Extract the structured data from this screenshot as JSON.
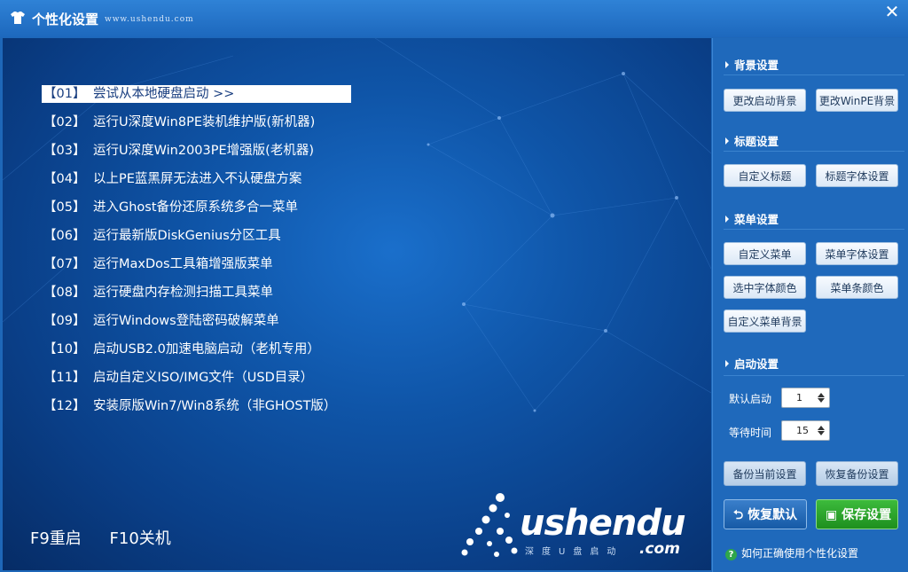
{
  "window": {
    "title": "个性化设置",
    "url": "www.ushendu.com",
    "close_label": "✕"
  },
  "menu": {
    "items": [
      {
        "num": "【01】",
        "label": "尝试从本地硬盘启动 >>"
      },
      {
        "num": "【02】",
        "label": "运行U深度Win8PE装机维护版(新机器)"
      },
      {
        "num": "【03】",
        "label": "运行U深度Win2003PE增强版(老机器)"
      },
      {
        "num": "【04】",
        "label": "以上PE蓝黑屏无法进入不认硬盘方案"
      },
      {
        "num": "【05】",
        "label": "进入Ghost备份还原系统多合一菜单"
      },
      {
        "num": "【06】",
        "label": "运行最新版DiskGenius分区工具"
      },
      {
        "num": "【07】",
        "label": "运行MaxDos工具箱增强版菜单"
      },
      {
        "num": "【08】",
        "label": "运行硬盘内存检测扫描工具菜单"
      },
      {
        "num": "【09】",
        "label": "运行Windows登陆密码破解菜单"
      },
      {
        "num": "【10】",
        "label": "启动USB2.0加速电脑启动（老机专用）"
      },
      {
        "num": "【11】",
        "label": "启动自定义ISO/IMG文件（USD目录）"
      },
      {
        "num": "【12】",
        "label": "安装原版Win7/Win8系统（非GHOST版）"
      }
    ],
    "selected_index": 0
  },
  "bottom_keys": {
    "reboot": "F9重启",
    "shutdown": "F10关机"
  },
  "logo": {
    "text": "ushendu",
    "sub": "深度U盘启动",
    "com": ".com"
  },
  "panel": {
    "background": {
      "title": "背景设置",
      "btn1": "更改启动背景",
      "btn2": "更改WinPE背景"
    },
    "heading": {
      "title": "标题设置",
      "btn1": "自定义标题",
      "btn2": "标题字体设置"
    },
    "menu": {
      "title": "菜单设置",
      "btn1": "自定义菜单",
      "btn2": "菜单字体设置",
      "btn3": "选中字体颜色",
      "btn4": "菜单条颜色",
      "btn5": "自定义菜单背景"
    },
    "boot": {
      "title": "启动设置",
      "default_label": "默认启动",
      "default_value": "1",
      "wait_label": "等待时间",
      "wait_value": "15"
    },
    "backup_btn": "备份当前设置",
    "restore_backup_btn": "恢复备份设置",
    "restore_default_btn": "恢复默认",
    "save_btn": "保存设置",
    "help_text": "如何正确使用个性化设置"
  },
  "colors": {
    "accent": "#1f69bb",
    "save_green": "#2aa52a",
    "selected_bg": "#ffffff"
  }
}
